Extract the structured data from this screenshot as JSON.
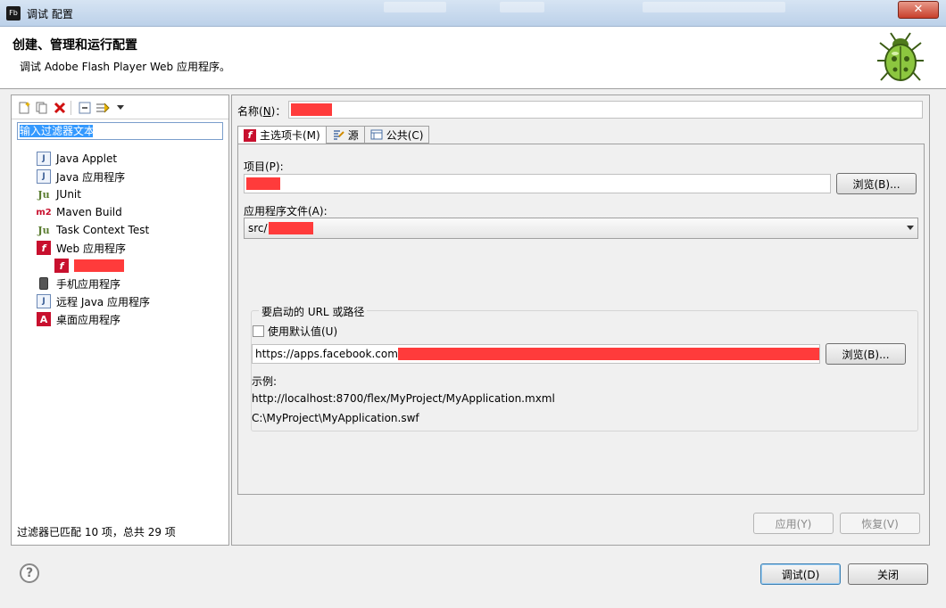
{
  "window": {
    "title": "调试 配置",
    "app_icon": "Fb",
    "close_label": "✕"
  },
  "header": {
    "title": "创建、管理和运行配置",
    "subtitle": "调试 Adobe Flash Player Web 应用程序。",
    "logo_icon": "bug-icon"
  },
  "left": {
    "toolbar": [
      "new-config-icon",
      "duplicate-icon",
      "delete-icon",
      "collapse-all-icon",
      "filter-icon",
      "dropdown-arrow-icon"
    ],
    "filter_value": "输入过滤器文本",
    "tree": [
      {
        "label": "Java Applet",
        "icon": "java-applet-icon"
      },
      {
        "label": "Java 应用程序",
        "icon": "java-app-icon"
      },
      {
        "label": "JUnit",
        "icon": "junit-icon"
      },
      {
        "label": "Maven Build",
        "icon": "maven-icon"
      },
      {
        "label": "Task Context Test",
        "icon": "task-context-icon"
      },
      {
        "label": "Web 应用程序",
        "icon": "flash-icon"
      },
      {
        "label": "",
        "icon": "flash-icon",
        "redacted": true
      },
      {
        "label": "手机应用程序",
        "icon": "phone-icon"
      },
      {
        "label": "远程 Java 应用程序",
        "icon": "remote-java-icon"
      },
      {
        "label": "桌面应用程序",
        "icon": "air-icon"
      }
    ],
    "status": "过滤器已匹配 10 项，总共 29 项"
  },
  "right": {
    "name_label": "名称(N)：",
    "name_label_plain": "名称(",
    "name_label_key": "N",
    "name_label_tail": ")：",
    "tabs": [
      {
        "label": "主选项卡(M)",
        "icon": "flash-icon",
        "active": true
      },
      {
        "label": "源",
        "icon": "source-icon",
        "active": false
      },
      {
        "label": "公共(C)",
        "icon": "common-icon",
        "active": false
      }
    ],
    "project_label": "项目(P):",
    "browse1": "浏览(B)...",
    "app_file_label": "应用程序文件(A):",
    "app_file_value": "src/",
    "url_group_title": "要启动的 URL 或路径",
    "use_default_label": "使用默认值(U)",
    "use_default_checked": false,
    "url_value": "https://apps.facebook.com/",
    "browse2": "浏览(B)...",
    "example_label": "示例:",
    "example1": "http://localhost:8700/flex/MyProject/MyApplication.mxml",
    "example2": "C:\\MyProject\\MyApplication.swf",
    "apply": "应用(Y)",
    "revert": "恢复(V)"
  },
  "footer": {
    "help_icon": "help-icon",
    "debug": "调试(D)",
    "close": "关闭"
  }
}
